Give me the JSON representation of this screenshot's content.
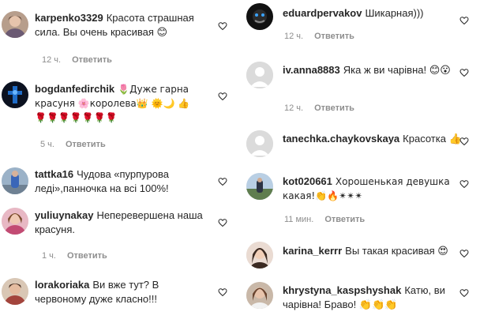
{
  "reply_label": "Ответить",
  "left": [
    {
      "user": "karpenko3329",
      "text": "Красота страшная сила. Вы очень красивая 😊",
      "time": "12 ч."
    },
    {
      "user": "bogdanfedirchik",
      "text": "🌷Дуже гарна красуня 🌸королева👑 🌞🌙 👍🌹🌹🌹🌹🌹🌹🌹",
      "time": "5 ч."
    },
    {
      "user": "tattka16",
      "text": "Чудова «пурпурова леді»,панночка на всі 100%!",
      "time": ""
    },
    {
      "user": "yuliuynakay",
      "text": "Неперевершена наша красуня.",
      "time": "1 ч."
    },
    {
      "user": "lorakoriaka",
      "text": "Ви вже тут? В червоному дуже класно!!!",
      "time": ""
    }
  ],
  "right": [
    {
      "user": "eduardpervakov",
      "text": "Шикарная)))",
      "time": "12 ч."
    },
    {
      "user": "iv.anna8883",
      "text": "Яка ж ви чарівна! 😊😮",
      "time": "12 ч."
    },
    {
      "user": "tanechka.chaykovskaya",
      "text": "Красотка 👍",
      "time": ""
    },
    {
      "user": "kot020661",
      "text": "Хорошенькая девушка какая!👏🔥✴✴✴",
      "time": "11 мин."
    },
    {
      "user": "karina_kerrr",
      "text": "Вы такая красивая 😍",
      "time": ""
    },
    {
      "user": "khrystyna_kaspshyshak",
      "text": "Катю, ви чарівна! Браво! 👏👏👏",
      "time": ""
    }
  ]
}
